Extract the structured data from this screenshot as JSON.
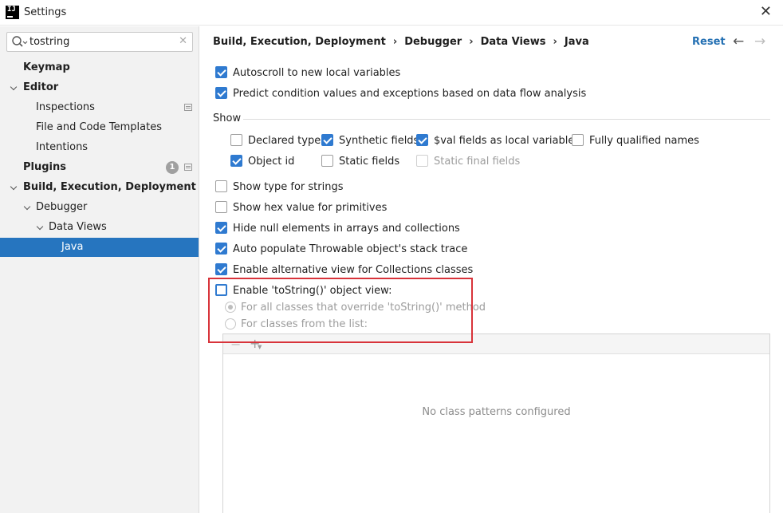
{
  "window": {
    "title": "Settings",
    "logo_text": "IJ"
  },
  "search": {
    "value": "tostring",
    "placeholder": ""
  },
  "sidebar": {
    "items": [
      {
        "label": "Keymap"
      },
      {
        "label": "Editor"
      },
      {
        "label": "Inspections"
      },
      {
        "label": "File and Code Templates"
      },
      {
        "label": "Intentions"
      },
      {
        "label": "Plugins",
        "badge": "1"
      },
      {
        "label": "Build, Execution, Deployment"
      },
      {
        "label": "Debugger"
      },
      {
        "label": "Data Views"
      },
      {
        "label": "Java"
      }
    ]
  },
  "header": {
    "breadcrumb": [
      "Build, Execution, Deployment",
      "Debugger",
      "Data Views",
      "Java"
    ],
    "reset_label": "Reset"
  },
  "options": {
    "autoscroll": {
      "label": "Autoscroll to new local variables",
      "checked": true
    },
    "predict": {
      "label": "Predict condition values and exceptions based on data flow analysis",
      "checked": true
    },
    "show_label": "Show",
    "show": {
      "declared_type": {
        "label": "Declared type",
        "checked": false
      },
      "synthetic_fields": {
        "label": "Synthetic fields",
        "checked": true
      },
      "val_fields": {
        "label": "$val fields as local variables",
        "checked": true
      },
      "fully_qualified": {
        "label": "Fully qualified names",
        "checked": false
      },
      "object_id": {
        "label": "Object id",
        "checked": true
      },
      "static_fields": {
        "label": "Static fields",
        "checked": false
      },
      "static_final_fields": {
        "label": "Static final fields",
        "checked": false,
        "disabled": true
      }
    },
    "show_type_strings": {
      "label": "Show type for strings",
      "checked": false
    },
    "show_hex": {
      "label": "Show hex value for primitives",
      "checked": false
    },
    "hide_null": {
      "label": "Hide null elements in arrays and collections",
      "checked": true
    },
    "auto_populate": {
      "label": "Auto populate Throwable object's stack trace",
      "checked": true
    },
    "alt_view": {
      "label": "Enable alternative view for Collections classes",
      "checked": true
    },
    "tostring_view": {
      "label": "Enable 'toString()' object view:",
      "checked": false
    },
    "radio_all": {
      "label": "For all classes that override 'toString()' method",
      "selected": true
    },
    "radio_list": {
      "label": "For classes from the list:",
      "selected": false
    }
  },
  "list": {
    "remove_icon": "minus-icon",
    "add_icon": "plus-icon",
    "empty_text": "No class patterns configured"
  },
  "colors": {
    "selection": "#2675bf",
    "accent": "#2f7ad0",
    "link": "#2470b3",
    "highlight": "#d8333a"
  }
}
